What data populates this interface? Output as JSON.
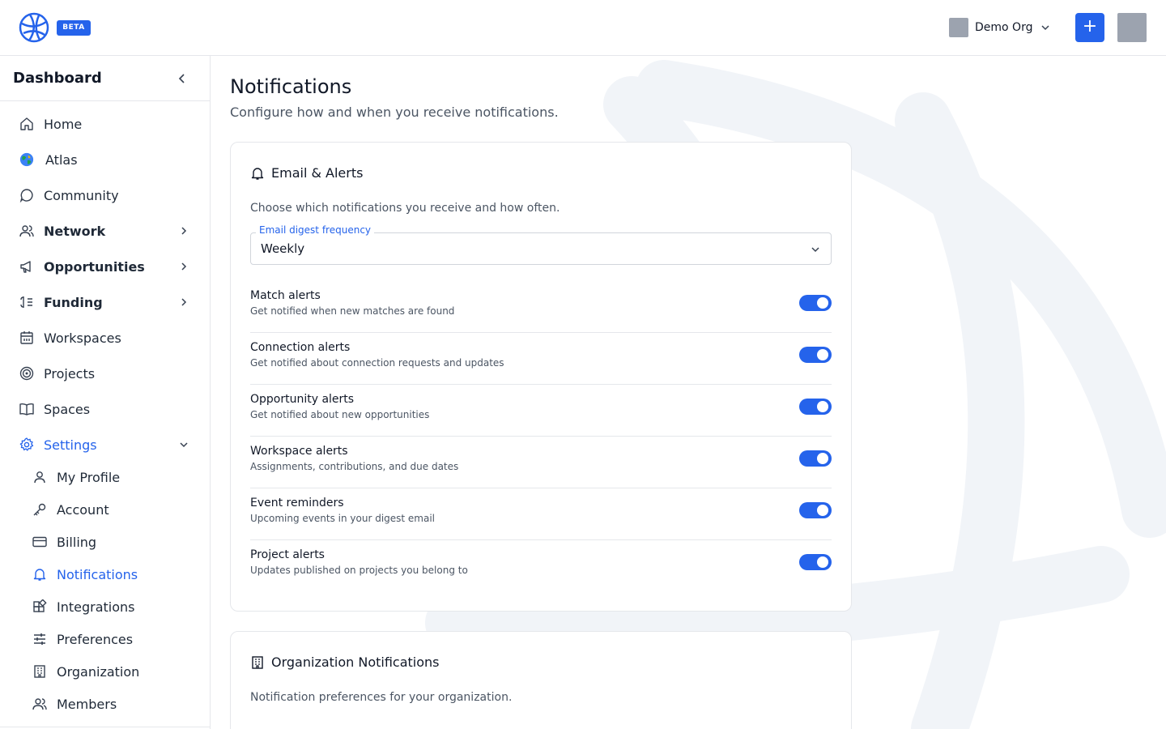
{
  "topbar": {
    "beta_label": "BETA",
    "org_name": "Demo Org",
    "add_label": "+"
  },
  "sidebar": {
    "title": "Dashboard",
    "items": [
      {
        "label": "Home",
        "icon": "home-icon"
      },
      {
        "label": "Atlas",
        "icon": "globe-icon"
      },
      {
        "label": "Community",
        "icon": "chat-bubble-icon"
      },
      {
        "label": "Network",
        "icon": "users-icon",
        "expandable": true
      },
      {
        "label": "Opportunities",
        "icon": "megaphone-icon",
        "expandable": true
      },
      {
        "label": "Funding",
        "icon": "funding-icon",
        "expandable": true
      },
      {
        "label": "Workspaces",
        "icon": "calendar-icon"
      },
      {
        "label": "Projects",
        "icon": "target-icon"
      },
      {
        "label": "Spaces",
        "icon": "book-icon"
      },
      {
        "label": "Settings",
        "icon": "gear-icon",
        "expanded": true
      }
    ],
    "settings_items": [
      {
        "label": "My Profile",
        "icon": "user-icon"
      },
      {
        "label": "Account",
        "icon": "key-icon"
      },
      {
        "label": "Billing",
        "icon": "credit-card-icon"
      },
      {
        "label": "Notifications",
        "icon": "bell-icon",
        "active": true
      },
      {
        "label": "Integrations",
        "icon": "puzzle-icon"
      },
      {
        "label": "Preferences",
        "icon": "sliders-icon"
      },
      {
        "label": "Organization",
        "icon": "building-icon"
      },
      {
        "label": "Members",
        "icon": "users-icon"
      }
    ]
  },
  "main": {
    "title": "Notifications",
    "subtitle": "Configure how and when you receive notifications."
  },
  "email_card": {
    "title": "Email & Alerts",
    "description": "Choose which notifications you receive and how often.",
    "digest_label": "Email digest frequency",
    "digest_value": "Weekly",
    "alerts": [
      {
        "title": "Match alerts",
        "desc": "Get notified when new matches are found",
        "enabled": true
      },
      {
        "title": "Connection alerts",
        "desc": "Get notified about connection requests and updates",
        "enabled": true
      },
      {
        "title": "Opportunity alerts",
        "desc": "Get notified about new opportunities",
        "enabled": true
      },
      {
        "title": "Workspace alerts",
        "desc": "Assignments, contributions, and due dates",
        "enabled": true
      },
      {
        "title": "Event reminders",
        "desc": "Upcoming events in your digest email",
        "enabled": true
      },
      {
        "title": "Project alerts",
        "desc": "Updates published on projects you belong to",
        "enabled": true
      }
    ]
  },
  "org_card": {
    "title": "Organization Notifications",
    "description": "Notification preferences for your organization."
  },
  "colors": {
    "accent": "#2563eb",
    "border": "#e5e7eb",
    "muted_text": "#4b5563"
  }
}
